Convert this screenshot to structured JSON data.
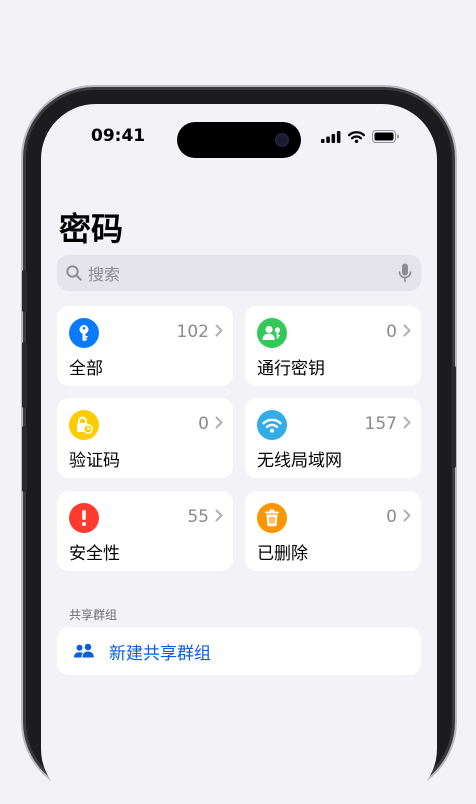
{
  "status": {
    "time": "09:41"
  },
  "page_title": "密码",
  "search": {
    "placeholder": "搜索"
  },
  "tiles": [
    {
      "label": "全部",
      "count": "102",
      "icon": "key-icon",
      "color": "#0a7aff"
    },
    {
      "label": "通行密钥",
      "count": "0",
      "icon": "passkey-person-icon",
      "color": "#34c759"
    },
    {
      "label": "验证码",
      "count": "0",
      "icon": "lock-clock-icon",
      "color": "#ffcc00"
    },
    {
      "label": "无线局域网",
      "count": "157",
      "icon": "wifi-icon",
      "color": "#32ade6"
    },
    {
      "label": "安全性",
      "count": "55",
      "icon": "exclamation-icon",
      "color": "#ff3b30"
    },
    {
      "label": "已删除",
      "count": "0",
      "icon": "trash-icon",
      "color": "#ff9500"
    }
  ],
  "shared_groups": {
    "header": "共享群组",
    "new_group_label": "新建共享群组",
    "accent": "#0a60d6"
  }
}
